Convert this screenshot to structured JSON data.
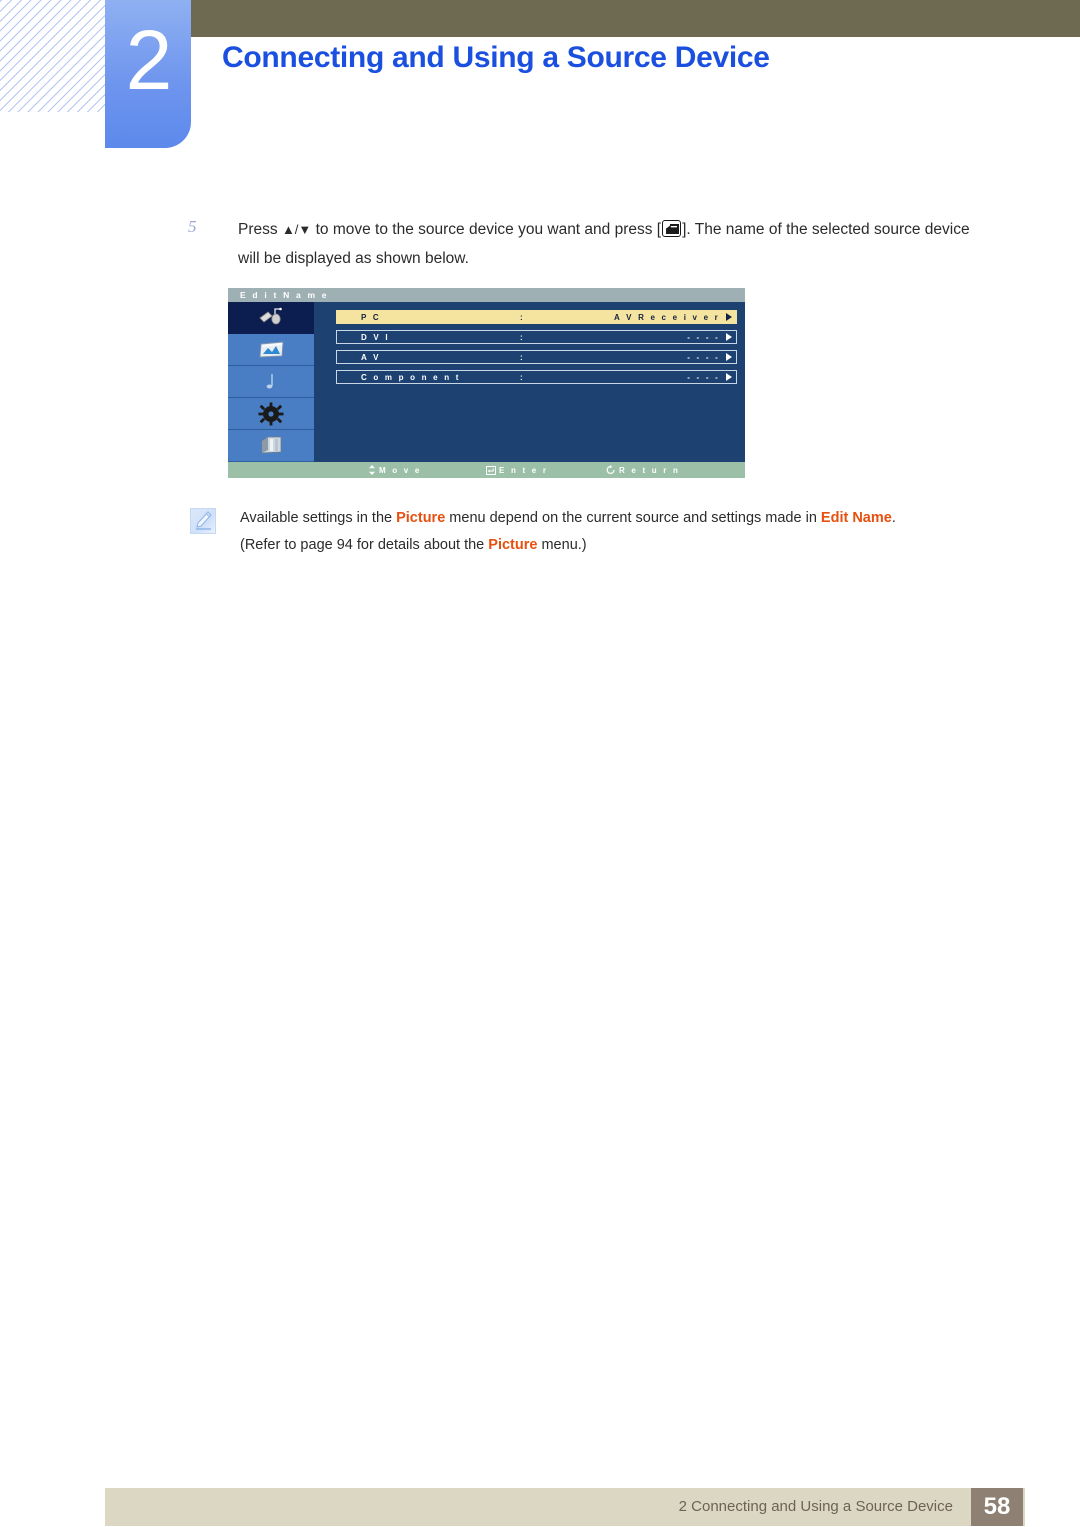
{
  "chapter": {
    "number": "2",
    "title": "Connecting and Using a Source Device"
  },
  "step": {
    "number": "5",
    "text_before_arrows": "Press",
    "arrows": "▲/▼",
    "text_middle": "to move to the source device you want and press [",
    "enter_icon": "enter-key-icon",
    "text_after": "]. The name of the selected source device will be displayed as shown below."
  },
  "osd": {
    "title": "E d i t  N a m e",
    "sidebar": [
      {
        "name": "input-source-icon",
        "active": true
      },
      {
        "name": "picture-icon",
        "active": false
      },
      {
        "name": "sound-icon",
        "active": false
      },
      {
        "name": "setup-gear-icon",
        "active": false
      },
      {
        "name": "multi-control-icon",
        "active": false
      }
    ],
    "rows": [
      {
        "label": "P C",
        "colon": ":",
        "value": "A V  R e c e i v e r",
        "selected": true
      },
      {
        "label": "D V I",
        "colon": ":",
        "value": "- - - -",
        "selected": false
      },
      {
        "label": "A V",
        "colon": ":",
        "value": "- - - -",
        "selected": false
      },
      {
        "label": "C o m p o n e n t",
        "colon": ":",
        "value": "- - - -",
        "selected": false
      }
    ],
    "footer": [
      {
        "icon": "move-updown-icon",
        "label": "M o v e"
      },
      {
        "icon": "enter-icon",
        "label": "E n t e r"
      },
      {
        "icon": "return-icon",
        "label": "R e t u r n"
      }
    ],
    "colors": {
      "background": "#1d4272",
      "sidebar": "#4a7ec4",
      "sidebar_active": "#0c1d4f",
      "titlebar": "#9fb0b5",
      "footerbar": "#9cbfa8",
      "selected_row": "#f5e3a0"
    }
  },
  "note": {
    "icon": "pencil-note-icon",
    "line1_part1": "Available settings in the ",
    "line1_hl1": "Picture",
    "line1_part2": " menu depend on the current source and settings made in ",
    "line1_hl2": "Edit Name",
    "line1_part3": ".",
    "line2_part1": "(Refer to page 94 for details about the ",
    "line2_hl1": "Picture",
    "line2_part2": " menu.)"
  },
  "footer": {
    "text": "2 Connecting and Using a Source Device",
    "page": "58"
  },
  "theme": {
    "olive": "#6e6a52",
    "tab_blue": "#6f96ee",
    "title_blue": "#1a4fe0",
    "footer_beige": "#dcd7c3",
    "footer_box": "#8e8073",
    "highlight_orange": "#e8500f"
  }
}
